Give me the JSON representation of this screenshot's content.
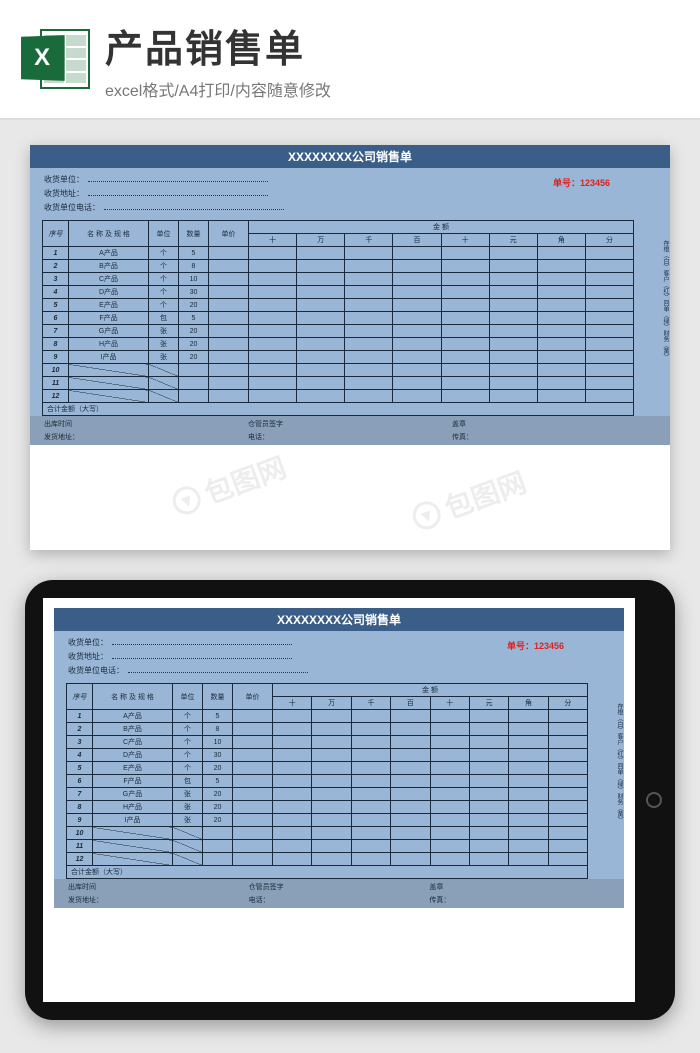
{
  "header": {
    "icon_letter": "X",
    "title": "产品销售单",
    "subtitle": "excel格式/A4打印/内容随意修改"
  },
  "form": {
    "title": "XXXXXXXX公司销售单",
    "recv_unit_label": "收货单位：",
    "recv_addr_label": "收货地址：",
    "recv_tel_label": "收货单位电话：",
    "order_no_label": "单号：",
    "order_no_value": "123456",
    "side_note": "存根（白）客户（红）回单（绿）财务（黄）",
    "cols": {
      "seq": "序号",
      "name": "名 称 及 规 格",
      "unit": "单位",
      "qty": "数量",
      "price": "单价",
      "amount": "金  额",
      "amt_sub": [
        "十",
        "万",
        "千",
        "百",
        "十",
        "元",
        "角",
        "分"
      ]
    },
    "rows": [
      {
        "seq": "1",
        "name": "A产品",
        "unit": "个",
        "qty": "5"
      },
      {
        "seq": "2",
        "name": "B产品",
        "unit": "个",
        "qty": "8"
      },
      {
        "seq": "3",
        "name": "C产品",
        "unit": "个",
        "qty": "10"
      },
      {
        "seq": "4",
        "name": "D产品",
        "unit": "个",
        "qty": "30"
      },
      {
        "seq": "5",
        "name": "E产品",
        "unit": "个",
        "qty": "20"
      },
      {
        "seq": "6",
        "name": "F产品",
        "unit": "包",
        "qty": "5"
      },
      {
        "seq": "7",
        "name": "G产品",
        "unit": "张",
        "qty": "20"
      },
      {
        "seq": "8",
        "name": "H产品",
        "unit": "张",
        "qty": "20"
      },
      {
        "seq": "9",
        "name": "I产品",
        "unit": "张",
        "qty": "20"
      },
      {
        "seq": "10",
        "name": "",
        "unit": "",
        "qty": ""
      },
      {
        "seq": "11",
        "name": "",
        "unit": "",
        "qty": ""
      },
      {
        "seq": "12",
        "name": "",
        "unit": "",
        "qty": ""
      }
    ],
    "total_label": "合计金额（大写）",
    "foot": {
      "ship_time": "出库时间",
      "ship_addr": "发货地址：",
      "keeper": "仓管员签字",
      "tel": "电话：",
      "stamp": "盖章",
      "fax": "传真："
    }
  },
  "watermark": "包图网"
}
